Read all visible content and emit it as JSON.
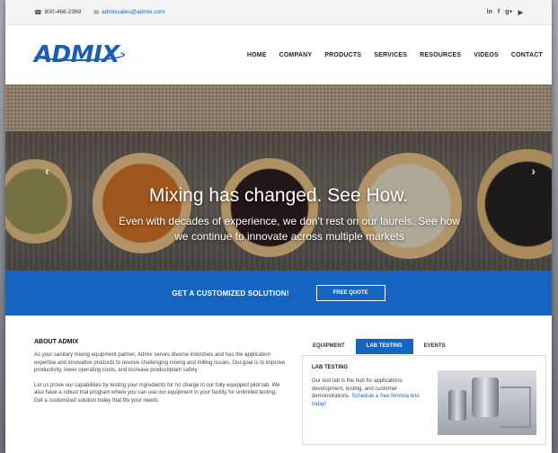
{
  "colors": {
    "brand_blue": "#1565c0",
    "logo_blue": "#1a5fb4"
  },
  "topbar": {
    "phone_icon": "phone-icon",
    "phone": "800-466-2369",
    "email_icon": "envelope-icon",
    "email": "admixsales@admix.com",
    "social": [
      "in",
      "f",
      "g+",
      "youtube-icon"
    ]
  },
  "navbar": {
    "logo": "ADMIX",
    "nav": [
      "HOME",
      "COMPANY",
      "PRODUCTS",
      "SERVICES",
      "RESOURCES",
      "VIDEOS",
      "CONTACT"
    ]
  },
  "hero": {
    "headline": "Mixing has changed. See How.",
    "subtext": "Even with decades of experience, we don't rest on our laurels. See how we continue to innovate across multiple markets",
    "prev_icon": "chevron-left-icon",
    "next_icon": "chevron-right-icon"
  },
  "cta": {
    "text": "GET A CUSTOMIZED SOLUTION!",
    "button": "FREE QUOTE"
  },
  "about": {
    "heading": "ABOUT ADMIX",
    "p1": "As your sanitary mixing equipment partner, Admix serves diverse industries and has the application expertise and innovative products to resolve challenging mixing and milling issues. Our goal is to improve productivity, lower operating costs, and increase product/plant safety.",
    "p2": "Let us prove our capabilities by testing your ingredients for no charge in our fully equipped pilot lab. We also have a robust trial program where you can use our equipment in your facility for unlimited testing. Get a customized solution today that fits your needs."
  },
  "tabs": {
    "items": [
      "EQUIPMENT",
      "LAB TESTING",
      "EVENTS"
    ],
    "active": "LAB TESTING",
    "panel_heading": "LAB TESTING",
    "panel_text": "Our test lab is the hub for applications development, testing, and customer demonstrations.",
    "panel_link": "Schedule a free formula test today!"
  }
}
